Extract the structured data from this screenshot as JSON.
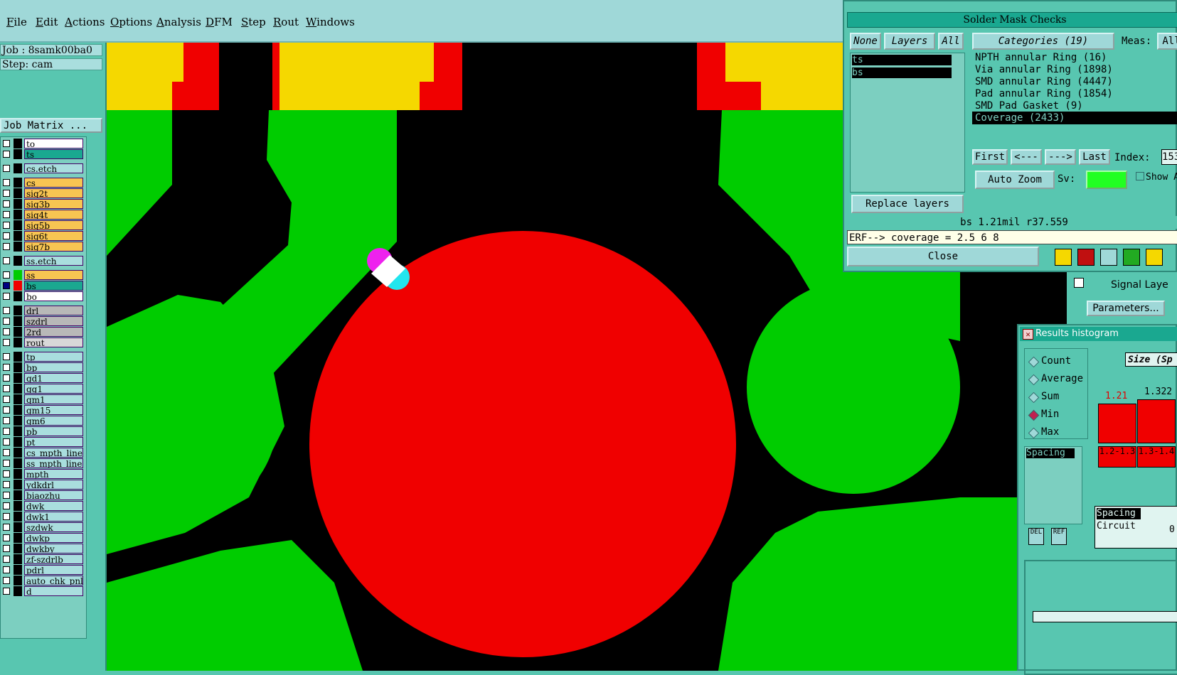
{
  "menubar": {
    "items": [
      "File",
      "Edit",
      "Actions",
      "Options",
      "Analysis",
      "DFM",
      "Step",
      "Rout",
      "Windows"
    ]
  },
  "left": {
    "job": "Job : 8samk00ba0",
    "step": "Step: cam",
    "job_matrix": "Job Matrix ...",
    "layers": [
      {
        "name": "to",
        "color": "#ffffff",
        "sel": false
      },
      {
        "name": "ts",
        "color": "#1aa890",
        "sel": false
      },
      {
        "name": "cs.etch",
        "color": "#a9dede",
        "sel": false
      },
      {
        "name": "cs",
        "color": "#f7c552",
        "sel": false
      },
      {
        "name": "sig2t",
        "color": "#f7c552",
        "sel": false
      },
      {
        "name": "sig3b",
        "color": "#f7c552",
        "sel": false
      },
      {
        "name": "sig4t",
        "color": "#f7c552",
        "sel": false
      },
      {
        "name": "sig5b",
        "color": "#f7c552",
        "sel": false
      },
      {
        "name": "sig6t",
        "color": "#f7c552",
        "sel": false
      },
      {
        "name": "sig7b",
        "color": "#f7c552",
        "sel": false
      },
      {
        "name": "ss.etch",
        "color": "#a9dede",
        "sel": false
      },
      {
        "name": "ss",
        "color": "#f7c552",
        "sel": false
      },
      {
        "name": "bs",
        "color": "#1aa890",
        "sel": true
      },
      {
        "name": "bo",
        "color": "#ffffff",
        "sel": false
      },
      {
        "name": "drl",
        "color": "#b8b8b8",
        "sel": false
      },
      {
        "name": "szdrl",
        "color": "#b8b8b8",
        "sel": false
      },
      {
        "name": "2rd",
        "color": "#b8b8b8",
        "sel": false
      },
      {
        "name": "rout",
        "color": "#d8d8d8",
        "sel": false
      },
      {
        "name": "tp",
        "color": "#a9dede",
        "sel": false
      },
      {
        "name": "bp",
        "color": "#a9dede",
        "sel": false
      },
      {
        "name": "gd1",
        "color": "#a9dede",
        "sel": false
      },
      {
        "name": "gg1",
        "color": "#a9dede",
        "sel": false
      },
      {
        "name": "gm1",
        "color": "#a9dede",
        "sel": false
      },
      {
        "name": "gm15",
        "color": "#a9dede",
        "sel": false
      },
      {
        "name": "gm6",
        "color": "#a9dede",
        "sel": false
      },
      {
        "name": "pb",
        "color": "#a9dede",
        "sel": false
      },
      {
        "name": "pt",
        "color": "#a9dede",
        "sel": false
      },
      {
        "name": "cs_mpth_line",
        "color": "#a9dede",
        "sel": false
      },
      {
        "name": "ss_mpth_line",
        "color": "#a9dede",
        "sel": false
      },
      {
        "name": "mpth",
        "color": "#a9dede",
        "sel": false
      },
      {
        "name": "ydkdrl",
        "color": "#a9dede",
        "sel": false
      },
      {
        "name": "biaozhu",
        "color": "#a9dede",
        "sel": false
      },
      {
        "name": "dwk",
        "color": "#a9dede",
        "sel": false
      },
      {
        "name": "dwk1",
        "color": "#a9dede",
        "sel": false
      },
      {
        "name": "szdwk",
        "color": "#a9dede",
        "sel": false
      },
      {
        "name": "dwkp",
        "color": "#a9dede",
        "sel": false
      },
      {
        "name": "dwkby",
        "color": "#a9dede",
        "sel": false
      },
      {
        "name": "zf-szdrlb",
        "color": "#a9dede",
        "sel": false
      },
      {
        "name": "pdrl",
        "color": "#a9dede",
        "sel": false
      },
      {
        "name": "auto_chk_pnl",
        "color": "#a9dede",
        "sel": false
      },
      {
        "name": "d",
        "color": "#a9dede",
        "sel": false
      }
    ]
  },
  "results_viewer": {
    "title": "Solder Mask Checks",
    "none_btn": "None",
    "layers_btn": "Layers",
    "all_btn": "All",
    "layer_items": [
      "ts",
      "bs"
    ],
    "categories_btn": "Categories (19)",
    "meas_label": "Meas:",
    "meas_value": "All",
    "categories": [
      "NPTH annular Ring (16)",
      "Via annular Ring (1898)",
      "SMD annular Ring (4447)",
      "Pad annular Ring (1854)",
      "SMD Pad Gasket (9)",
      "Coverage (2433)"
    ],
    "nav": {
      "first": "First",
      "prev": "<---",
      "next": "--->",
      "last": "Last",
      "index_label": "Index:",
      "index_value": "153"
    },
    "auto_zoom": "Auto Zoom",
    "sv_label": "Sv:",
    "show_label": "Show A",
    "replace_layers": "Replace layers",
    "status": "bs 1.21mil  r37.559",
    "erf": "ERF--> coverage = 2.5 6 8",
    "close": "Close",
    "del": "DEL",
    "ref": "REF"
  },
  "side_panel": {
    "signal_label": "Signal Laye",
    "parameters": "Parameters..."
  },
  "histogram": {
    "title": "Results histogram",
    "options": [
      "Count",
      "Average",
      "Sum",
      "Min",
      "Max"
    ],
    "selected": "Min",
    "size_header": "Size (Sp",
    "list_items": [
      "Spacing"
    ],
    "bars": [
      {
        "value_label": "1.21",
        "range_label": "1.2-1.3",
        "value_color": "#e00000"
      },
      {
        "value_label": "1.322",
        "range_label": "1.3-1.4",
        "value_color": "#000000"
      }
    ],
    "list2": [
      "Spacing",
      "Circuit"
    ],
    "del": "DEL",
    "ref": "REF",
    "zero": "0"
  },
  "colors": {
    "green": "#00cc00",
    "red": "#f00000",
    "yellow": "#f5d800",
    "magenta": "#ee22ee",
    "cyan": "#22e5ee"
  }
}
